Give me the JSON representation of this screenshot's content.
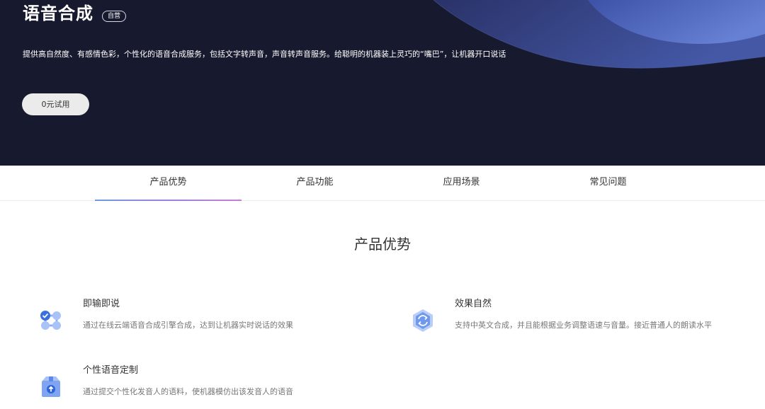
{
  "hero": {
    "title": "语音合成",
    "badge": "自营",
    "description": "提供高自然度、有感情色彩，个性化的语音合成服务，包括文字转声音，声音转声音服务。给聪明的机器装上灵巧的“嘴巴”，让机器开口说话",
    "trial_button": "0元试用",
    "colors": {
      "background": "#171a2e",
      "wave_light": "#5063b4",
      "wave_dark": "#2e3872"
    }
  },
  "tabs": [
    {
      "label": "产品优势",
      "active": true
    },
    {
      "label": "产品功能",
      "active": false
    },
    {
      "label": "应用场景",
      "active": false
    },
    {
      "label": "常见问题",
      "active": false
    }
  ],
  "section": {
    "title": "产品优势",
    "features": [
      {
        "title": "即输即说",
        "description": "通过在线云端语音合成引擎合成，达到让机器实时说话的效果",
        "icon": "nodes-check-icon"
      },
      {
        "title": "效果自然",
        "description": "支持中英文合成，并且能根据业务调整语速与音量。接近普通人的朗读水平",
        "icon": "refresh-hexagon-icon"
      },
      {
        "title": "个性语音定制",
        "description": "通过提交个性化发音人的语料，使机器模仿出该发音人的语音",
        "icon": "package-upload-icon"
      }
    ]
  },
  "accent_color": "#4a7ee8"
}
